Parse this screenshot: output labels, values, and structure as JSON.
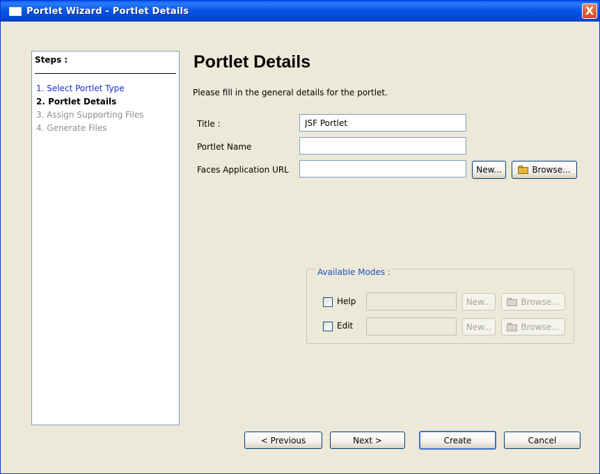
{
  "window": {
    "title": "Portlet Wizard - Portlet Details",
    "close_label": "X"
  },
  "steps": {
    "header": "Steps :",
    "items": [
      {
        "label": "1. Select Portlet Type",
        "state": "link"
      },
      {
        "label": "2. Portlet Details",
        "state": "current"
      },
      {
        "label": "3. Assign Supporting Files",
        "state": "disabled"
      },
      {
        "label": "4. Generate Files",
        "state": "disabled"
      }
    ]
  },
  "page": {
    "title": "Portlet Details",
    "description": "Please fill in the general details for the portlet."
  },
  "form": {
    "title_label": "Title :",
    "title_value": "JSF Portlet",
    "portlet_name_label": "Portlet Name",
    "portlet_name_value": "",
    "faces_url_label": "Faces Application URL",
    "faces_url_value": "",
    "new_label": "New...",
    "browse_label": "Browse..."
  },
  "modes": {
    "legend": "Available Modes :",
    "help": {
      "label": "Help",
      "checked": false,
      "value": "",
      "new_label": "New...",
      "browse_label": "Browse..."
    },
    "edit": {
      "label": "Edit",
      "checked": false,
      "value": "",
      "new_label": "New...",
      "browse_label": "Browse..."
    }
  },
  "footer": {
    "previous_label": "< Previous",
    "next_label": "Next >",
    "create_label": "Create",
    "cancel_label": "Cancel"
  },
  "colors": {
    "titlebar": "#0655E8",
    "window_bg": "#ECE9D8",
    "step_link": "#1E2ECC",
    "legend": "#1F4FC2"
  }
}
